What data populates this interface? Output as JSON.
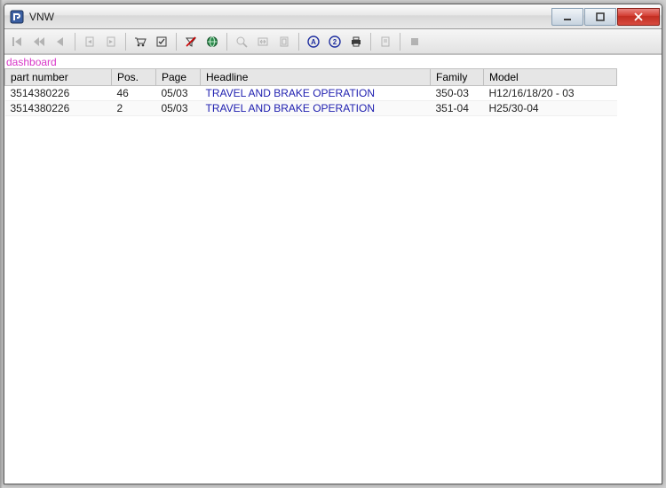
{
  "window": {
    "title": "VNW"
  },
  "toolbar": {
    "section_label": "dashboard"
  },
  "table": {
    "headers": {
      "part_number": "part number",
      "pos": "Pos.",
      "page": "Page",
      "headline": "Headline",
      "family": "Family",
      "model": "Model"
    },
    "rows": [
      {
        "part_number": "3514380226",
        "pos": "46",
        "page": "05/03",
        "headline": "TRAVEL AND BRAKE OPERATION",
        "family": "350-03",
        "model": "H12/16/18/20 - 03"
      },
      {
        "part_number": "3514380226",
        "pos": "2",
        "page": "05/03",
        "headline": "TRAVEL AND BRAKE OPERATION",
        "family": "351-04",
        "model": "H25/30-04"
      }
    ]
  },
  "icons": {
    "first": "first-icon",
    "prev_fast": "rewind-icon",
    "prev": "back-icon",
    "doc_prev": "doc-prev-icon",
    "doc_next": "doc-next-icon",
    "cart": "cart-icon",
    "check": "checklist-icon",
    "no_filter": "no-filter-icon",
    "globe": "globe-icon",
    "zoom": "zoom-icon",
    "fit_w": "fit-width-icon",
    "fit_p": "fit-page-icon",
    "mark_a": "mark-a-icon",
    "mark_q": "mark-q-icon",
    "print": "print-icon",
    "note": "note-icon",
    "stop": "stop-icon"
  }
}
